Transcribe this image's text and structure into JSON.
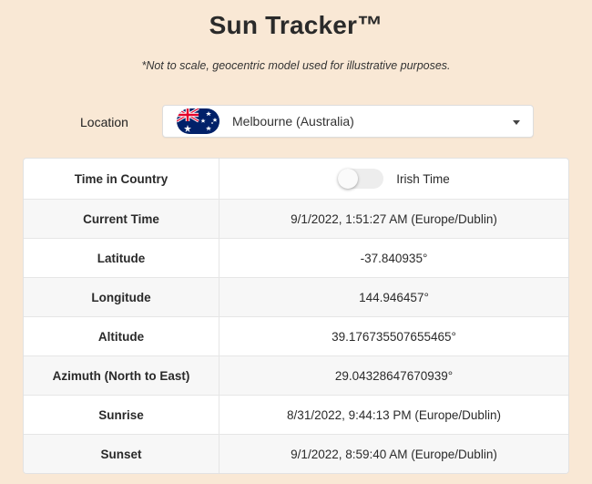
{
  "header": {
    "title": "Sun Tracker™",
    "subtitle": "*Not to scale, geocentric model used for illustrative purposes."
  },
  "location": {
    "label": "Location",
    "selected": "Melbourne (Australia)",
    "flag_icon": "australia-flag-icon"
  },
  "toggle": {
    "label": "Irish Time",
    "on": false
  },
  "table": {
    "rows": [
      {
        "label": "Time in Country",
        "value": ""
      },
      {
        "label": "Current Time",
        "value": "9/1/2022, 1:51:27 AM (Europe/Dublin)"
      },
      {
        "label": "Latitude",
        "value": "-37.840935°"
      },
      {
        "label": "Longitude",
        "value": "144.946457°"
      },
      {
        "label": "Altitude",
        "value": "39.176735507655465°"
      },
      {
        "label": "Azimuth (North to East)",
        "value": "29.04328647670939°"
      },
      {
        "label": "Sunrise",
        "value": "8/31/2022, 9:44:13 PM (Europe/Dublin)"
      },
      {
        "label": "Sunset",
        "value": "9/1/2022, 8:59:40 AM (Europe/Dublin)"
      }
    ]
  },
  "colors": {
    "background": "#f9e8d5",
    "flag_blue": "#012169",
    "flag_red": "#e4002b"
  }
}
